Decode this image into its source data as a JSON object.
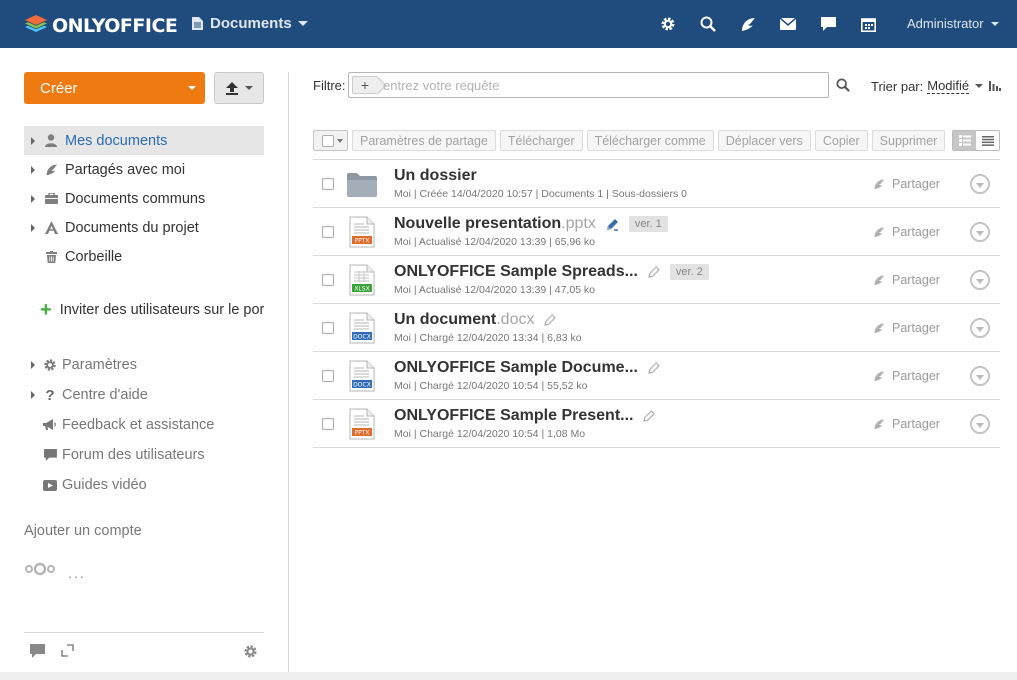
{
  "header": {
    "brand": "ONLYOFFICE",
    "module": "Documents",
    "user": "Administrator",
    "icons": [
      "gear-icon",
      "search-icon",
      "feed-icon",
      "mail-icon",
      "chat-icon",
      "calendar-icon"
    ]
  },
  "sidebar": {
    "create_label": "Créer",
    "tree": [
      {
        "label": "Mes documents",
        "icon": "user-icon",
        "active": true
      },
      {
        "label": "Partagés avec moi",
        "icon": "share-icon"
      },
      {
        "label": "Documents communs",
        "icon": "common-icon"
      },
      {
        "label": "Documents du projet",
        "icon": "project-icon"
      },
      {
        "label": "Corbeille",
        "icon": "trash-icon"
      }
    ],
    "invite_label": "Inviter des utilisateurs sur le portail",
    "links": [
      {
        "label": "Paramètres",
        "icon": "gear-icon"
      },
      {
        "label": "Centre d'aide",
        "icon": "help-icon"
      },
      {
        "label": "Feedback et assistance",
        "icon": "megaphone-icon"
      },
      {
        "label": "Forum des utilisateurs",
        "icon": "forum-icon"
      },
      {
        "label": "Guides vidéo",
        "icon": "video-icon"
      }
    ],
    "add_account_label": "Ajouter un compte",
    "more_dots": "..."
  },
  "filter": {
    "label": "Filtre:",
    "placeholder": "entrez votre requête",
    "sort_label": "Trier par:",
    "sort_value": "Modifié"
  },
  "toolbar": {
    "buttons": [
      "Paramètres de partage",
      "Télécharger",
      "Télécharger comme",
      "Déplacer vers",
      "Copier",
      "Supprimer"
    ]
  },
  "files": [
    {
      "name": "Un dossier",
      "ext": "",
      "type": "folder",
      "meta": "Moi | Créée 14/04/2020 10:57 | Documents 1 | Sous-dossiers 0",
      "version": "",
      "share": "Partager"
    },
    {
      "name": "Nouvelle presentation",
      "ext": ".pptx",
      "type": "pptx",
      "meta": "Moi | Actualisé 12/04/2020 13:39 | 65,96 ko",
      "version": "ver. 1",
      "share": "Partager"
    },
    {
      "name": "ONLYOFFICE Sample Spreads...",
      "ext": "",
      "type": "xlsx",
      "meta": "Moi | Actualisé 12/04/2020 13:39 | 47,05 ko",
      "version": "ver. 2",
      "share": "Partager"
    },
    {
      "name": "Un document",
      "ext": ".docx",
      "type": "docx",
      "meta": "Moi | Chargé 12/04/2020 13:34 | 6,83 ko",
      "version": "",
      "share": "Partager"
    },
    {
      "name": "ONLYOFFICE Sample Docume...",
      "ext": "",
      "type": "docx",
      "meta": "Moi | Chargé 12/04/2020 10:54 | 55,52 ko",
      "version": "",
      "share": "Partager"
    },
    {
      "name": "ONLYOFFICE Sample Present...",
      "ext": "",
      "type": "pptx",
      "meta": "Moi | Chargé 12/04/2020 10:54 | 1,08 Mo",
      "version": "",
      "share": "Partager"
    }
  ],
  "file_type_labels": {
    "pptx": "PPTX",
    "xlsx": "XLSX",
    "docx": "DOCX"
  },
  "colors": {
    "header": "#1f4b7d",
    "create": "#ee7a11",
    "active_link": "#2a6db0",
    "pptx": "#e06a2a",
    "xlsx": "#3aa33a",
    "docx": "#2f6db6"
  }
}
